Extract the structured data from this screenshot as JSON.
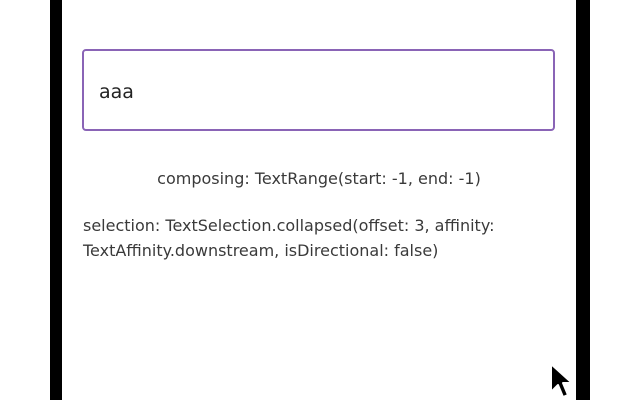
{
  "text_field": {
    "value": "aaa",
    "border_color": "#8a64b6"
  },
  "status": {
    "composing": "composing: TextRange(start: -1, end: -1)",
    "selection": "selection: TextSelection.collapsed(offset: 3, affinity: TextAffinity.downstream, isDirectional: false)"
  },
  "icons": {
    "cursor": "mouse-pointer-icon"
  }
}
